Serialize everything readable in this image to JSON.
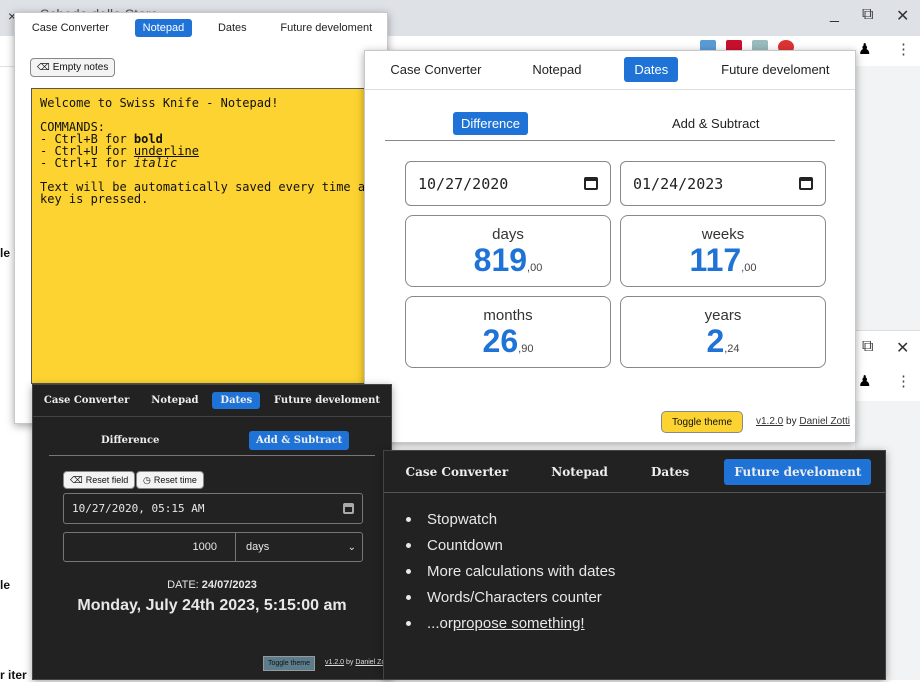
{
  "browser": {
    "tab_title": "Scheda dello Store",
    "tab_close": "×",
    "new_tab": "+",
    "minimize": "_",
    "restore": "⧉",
    "close": "✕",
    "edge_fragments": [
      "le",
      "le",
      "r iter"
    ]
  },
  "nav": {
    "case_converter": "Case Converter",
    "notepad": "Notepad",
    "dates": "Dates",
    "future": "Future develoment"
  },
  "notepad": {
    "empty_label": "Empty notes",
    "lines": [
      "Welcome to Swiss Knife - Notepad!",
      "",
      "COMMANDS:",
      "- Ctrl+B for ",
      "- Ctrl+U for ",
      "- Ctrl+I for ",
      "",
      "Text will be automatically saved every time a",
      "key is pressed."
    ],
    "bold_word": "bold",
    "underline_word": "underline",
    "italic_word": "italic"
  },
  "dates_light": {
    "subtab_difference": "Difference",
    "subtab_add": "Add & Subtract",
    "date_from": "10/27/2020",
    "date_to": "01/24/2023",
    "cards": [
      {
        "label": "days",
        "int": "819",
        "dec": ",00"
      },
      {
        "label": "weeks",
        "int": "117",
        "dec": ",00"
      },
      {
        "label": "months",
        "int": "26",
        "dec": ",90"
      },
      {
        "label": "years",
        "int": "2",
        "dec": ",24"
      }
    ],
    "toggle_theme": "Toggle theme",
    "version": "v1.2.0",
    "by": "by",
    "author": "Daniel Zotti"
  },
  "dates_dark": {
    "subtab_difference": "Difference",
    "subtab_add": "Add & Subtract",
    "reset_field": "Reset field",
    "reset_time": "Reset time",
    "datetime_value": "10/27/2020, 05:15 AM",
    "amount": "1000",
    "unit": "days",
    "date_label": "DATE:",
    "date_short": "24/07/2023",
    "date_long": "Monday, July 24th 2023, 5:15:00 am",
    "toggle_theme": "Toggle theme",
    "version": "v1.2.0",
    "by": "by",
    "author": "Daniel Zo"
  },
  "future": {
    "items": [
      "Stopwatch",
      "Countdown",
      "More calculations with dates",
      "Words/Characters counter"
    ],
    "last_prefix": "...or ",
    "last_link": "propose something!"
  },
  "colors": {
    "accent": "#1f73d6",
    "note_yellow": "#fdd331",
    "toggle_yellow": "#fdd331",
    "dark_bg": "#222222"
  }
}
